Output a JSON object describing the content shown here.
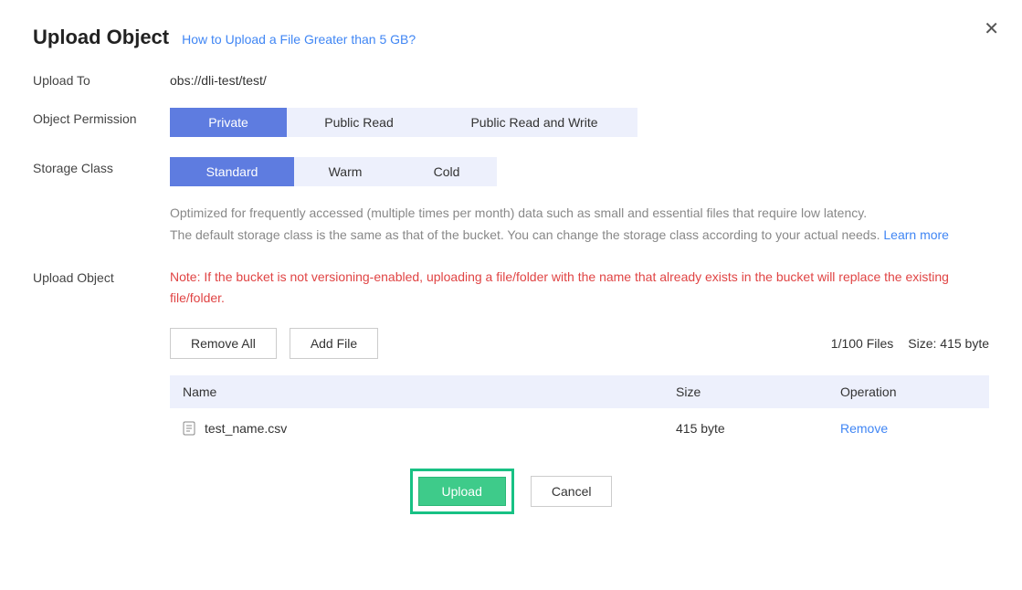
{
  "title": "Upload Object",
  "help_link": "How to Upload a File Greater than 5 GB?",
  "upload_to": {
    "label": "Upload To",
    "value": "obs://dli-test/test/"
  },
  "permission": {
    "label": "Object Permission",
    "options": {
      "private": "Private",
      "public_read": "Public Read",
      "public_rw": "Public Read and Write"
    },
    "selected": "private"
  },
  "storage": {
    "label": "Storage Class",
    "options": {
      "standard": "Standard",
      "warm": "Warm",
      "cold": "Cold"
    },
    "selected": "standard",
    "desc1": "Optimized for frequently accessed (multiple times per month) data such as small and essential files that require low latency.",
    "desc2": "The default storage class is the same as that of the bucket. You can change the storage class according to your actual needs. ",
    "learn": "Learn more"
  },
  "upload_section": {
    "label": "Upload Object",
    "note": "Note: If the bucket is not versioning-enabled, uploading a file/folder with the name that already exists in the bucket will replace the existing file/folder.",
    "remove_all": "Remove All",
    "add_file": "Add File",
    "stats_files": "1/100 Files",
    "stats_size": "Size: 415 byte"
  },
  "table": {
    "headers": {
      "name": "Name",
      "size": "Size",
      "operation": "Operation"
    },
    "rows": [
      {
        "name": "test_name.csv",
        "size": "415 byte",
        "operation": "Remove"
      }
    ]
  },
  "footer": {
    "upload": "Upload",
    "cancel": "Cancel"
  }
}
